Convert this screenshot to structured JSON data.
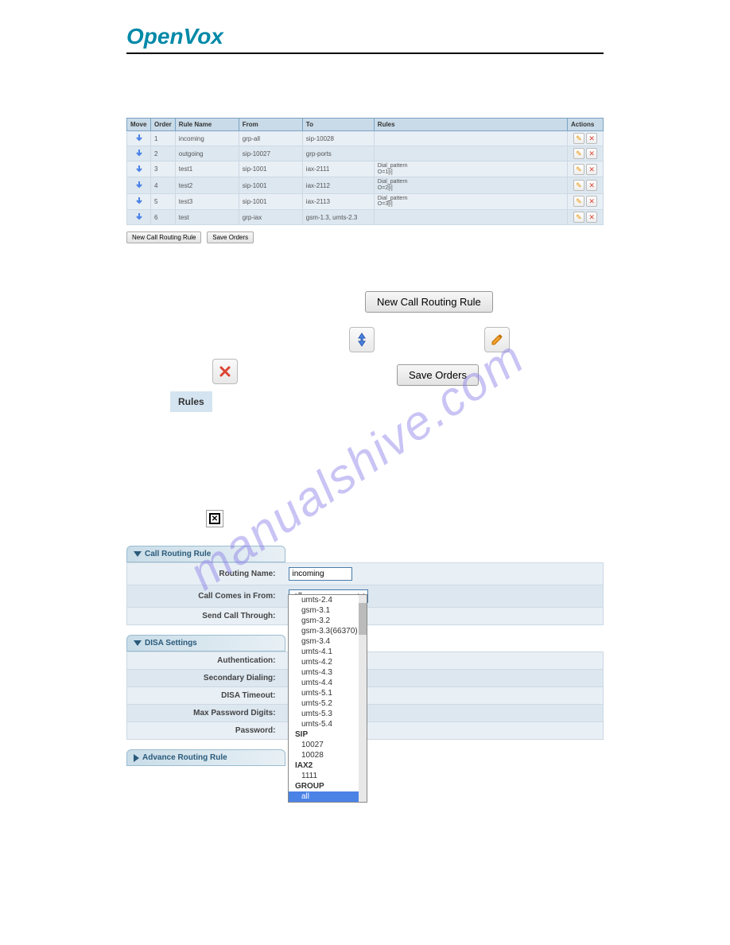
{
  "logo": {
    "part1": "Open",
    "part2": "Vox"
  },
  "table": {
    "headers": [
      "Move",
      "Order",
      "Rule Name",
      "From",
      "To",
      "Rules",
      "Actions"
    ],
    "rows": [
      {
        "order": "1",
        "name": "incoming",
        "from": "grp-all",
        "to": "sip-10028",
        "rules": ""
      },
      {
        "order": "2",
        "name": "outgoing",
        "from": "sip-10027",
        "to": "grp-ports",
        "rules": ""
      },
      {
        "order": "3",
        "name": "test1",
        "from": "sip-1001",
        "to": "iax-2111",
        "rules": "Dial_pattern\nO=1[i]"
      },
      {
        "order": "4",
        "name": "test2",
        "from": "sip-1001",
        "to": "iax-2112",
        "rules": "Dial_pattern\nO=2[i]"
      },
      {
        "order": "5",
        "name": "test3",
        "from": "sip-1001",
        "to": "iax-2113",
        "rules": "Dial_pattern\nO=3[i]"
      },
      {
        "order": "6",
        "name": "test",
        "from": "grp-iax",
        "to": "gsm-1.3, umts-2.3",
        "rules": ""
      }
    ]
  },
  "buttons": {
    "new_rule_small": "New Call Routing Rule",
    "save_orders_small": "Save Orders",
    "new_rule_big": "New Call Routing Rule",
    "save_orders_big": "Save Orders",
    "rules_label": "Rules"
  },
  "sections": {
    "call_routing": "Call Routing Rule",
    "disa": "DISA Settings",
    "advance": "Advance Routing Rule"
  },
  "form": {
    "routing_name_label": "Routing Name:",
    "routing_name_value": "incoming",
    "call_from_label": "Call Comes in From:",
    "call_from_value": "all",
    "send_through_label": "Send Call Through:",
    "auth_label": "Authentication:",
    "secondary_label": "Secondary Dialing:",
    "disa_timeout_label": "DISA Timeout:",
    "max_pwd_label": "Max Password Digits:",
    "password_label": "Password:"
  },
  "dropdown": {
    "options": [
      {
        "text": "umts-2.4",
        "indent": true
      },
      {
        "text": "gsm-3.1",
        "indent": true
      },
      {
        "text": "gsm-3.2",
        "indent": true
      },
      {
        "text": "gsm-3.3(66370)",
        "indent": true
      },
      {
        "text": "gsm-3.4",
        "indent": true
      },
      {
        "text": "umts-4.1",
        "indent": true
      },
      {
        "text": "umts-4.2",
        "indent": true
      },
      {
        "text": "umts-4.3",
        "indent": true
      },
      {
        "text": "umts-4.4",
        "indent": true
      },
      {
        "text": "umts-5.1",
        "indent": true
      },
      {
        "text": "umts-5.2",
        "indent": true
      },
      {
        "text": "umts-5.3",
        "indent": true
      },
      {
        "text": "umts-5.4",
        "indent": true
      },
      {
        "text": "SIP",
        "group": true
      },
      {
        "text": "10027",
        "indent": true
      },
      {
        "text": "10028",
        "indent": true
      },
      {
        "text": "IAX2",
        "group": true
      },
      {
        "text": "1111",
        "indent": true
      },
      {
        "text": "GROUP",
        "group": true
      },
      {
        "text": "all",
        "indent": true,
        "selected": true
      }
    ]
  },
  "watermark": "manualshive.com"
}
